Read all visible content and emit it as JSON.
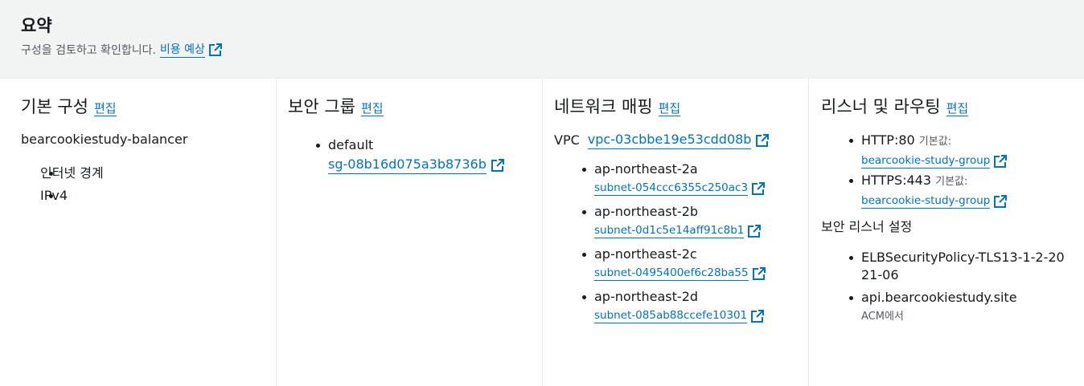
{
  "header": {
    "title": "요약",
    "description": "구성을 검토하고 확인합니다.",
    "cost_link": "비용 예상"
  },
  "basic": {
    "title": "기본 구성",
    "edit": "편집",
    "name": "bearcookiestudy-balancer",
    "items": [
      "인터넷 경계",
      "IPv4"
    ]
  },
  "security": {
    "title": "보안 그룹",
    "edit": "편집",
    "items": [
      {
        "name": "default",
        "id": "sg-08b16d075a3b8736b"
      }
    ]
  },
  "network": {
    "title": "네트워크 매핑",
    "edit": "편집",
    "vpc_label": "VPC",
    "vpc_id": "vpc-03cbbe19e53cdd08b",
    "subnets": [
      {
        "az": "ap-northeast-2a",
        "subnet": "subnet-054ccc6355c250ac3"
      },
      {
        "az": "ap-northeast-2b",
        "subnet": "subnet-0d1c5e14aff91c8b1"
      },
      {
        "az": "ap-northeast-2c",
        "subnet": "subnet-0495400ef6c28ba55"
      },
      {
        "az": "ap-northeast-2d",
        "subnet": "subnet-085ab88ccefe10301"
      }
    ]
  },
  "listeners": {
    "title": "리스너 및 라우팅",
    "edit": "편집",
    "items": [
      {
        "protocol": "HTTP:80",
        "default_label": "기본값:",
        "target": "bearcookie-study-group"
      },
      {
        "protocol": "HTTPS:443",
        "default_label": "기본값:",
        "target": "bearcookie-study-group"
      }
    ],
    "secure_title": "보안 리스너 설정",
    "secure_items": [
      {
        "text": "ELBSecurityPolicy-TLS13-1-2-2021-06"
      },
      {
        "text": "api.bearcookiestudy.site",
        "sub": "ACM에서"
      }
    ]
  },
  "colors": {
    "link": "#0073bb",
    "header_bg": "#f2f3f3"
  }
}
